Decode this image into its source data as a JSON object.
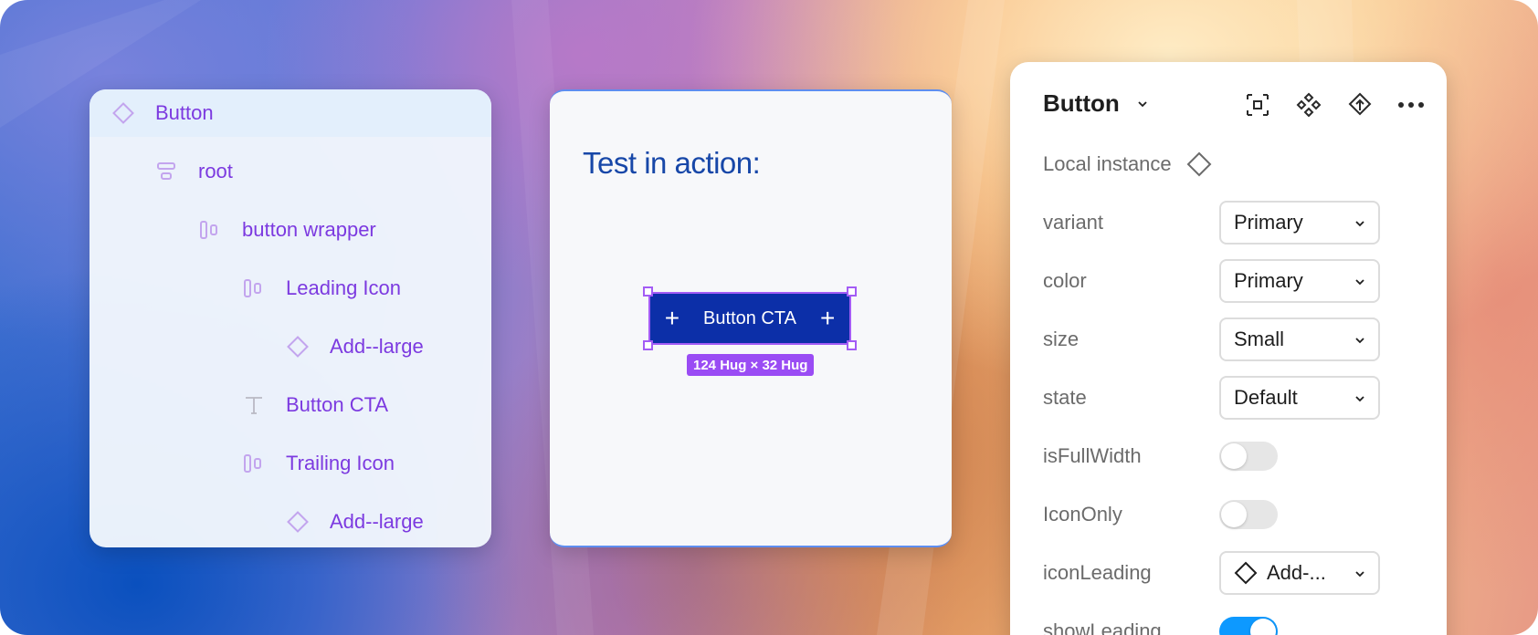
{
  "layers": {
    "items": [
      {
        "label": "Button",
        "icon": "component-instance-icon",
        "indent": 0,
        "selected": true
      },
      {
        "label": "root",
        "icon": "auto-layout-vertical-icon",
        "indent": 1
      },
      {
        "label": "button wrapper",
        "icon": "auto-layout-horizontal-icon",
        "indent": 2
      },
      {
        "label": "Leading Icon",
        "icon": "auto-layout-horizontal-icon",
        "indent": 3
      },
      {
        "label": "Add--large",
        "icon": "component-instance-icon",
        "indent": 4
      },
      {
        "label": "Button CTA",
        "icon": "text-icon",
        "indent": 3
      },
      {
        "label": "Trailing Icon",
        "icon": "auto-layout-horizontal-icon",
        "indent": 3
      },
      {
        "label": "Add--large",
        "icon": "component-instance-icon",
        "indent": 4
      }
    ]
  },
  "canvas": {
    "title": "Test in action:",
    "button_label": "Button CTA",
    "size_badge": "124 Hug × 32 Hug"
  },
  "properties": {
    "title": "Button",
    "local_instance_label": "Local instance",
    "header_icons": [
      "detach-instance-icon",
      "component-icon",
      "go-to-main-component-icon",
      "more-icon"
    ],
    "rows": [
      {
        "label": "variant",
        "type": "select",
        "value": "Primary"
      },
      {
        "label": "color",
        "type": "select",
        "value": "Primary"
      },
      {
        "label": "size",
        "type": "select",
        "value": "Small"
      },
      {
        "label": "state",
        "type": "select",
        "value": "Default"
      },
      {
        "label": "isFullWidth",
        "type": "toggle",
        "on": false
      },
      {
        "label": "IconOnly",
        "type": "toggle",
        "on": false
      },
      {
        "label": "iconLeading",
        "type": "select",
        "value": "Add-...",
        "icon": "component-instance-icon"
      },
      {
        "label": "showLeading",
        "type": "toggle",
        "on": true
      }
    ]
  },
  "colors": {
    "accent_purple": "#7c3ae0",
    "selection": "#a35cf5",
    "cta_background": "#0c2fa8",
    "toggle_on": "#0d99ff"
  }
}
